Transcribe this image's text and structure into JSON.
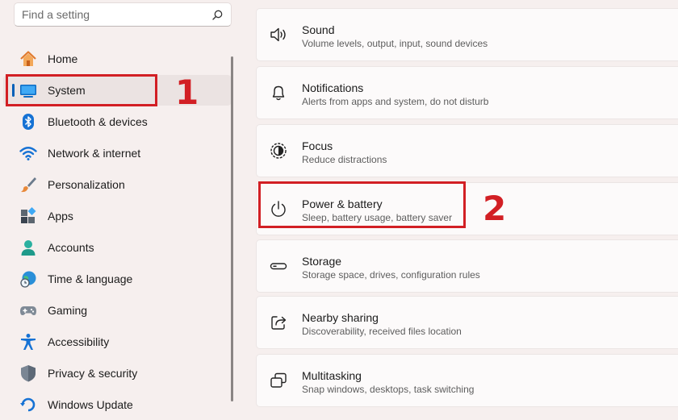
{
  "search": {
    "placeholder": "Find a setting",
    "icon": "search-icon"
  },
  "sidebar": {
    "selected_accent": "#005fb8",
    "items": [
      {
        "label": "Home",
        "icon": "home-icon"
      },
      {
        "label": "System",
        "icon": "system-display-icon",
        "selected": true
      },
      {
        "label": "Bluetooth & devices",
        "icon": "bluetooth-icon"
      },
      {
        "label": "Network & internet",
        "icon": "wifi-icon"
      },
      {
        "label": "Personalization",
        "icon": "paintbrush-icon"
      },
      {
        "label": "Apps",
        "icon": "apps-icon"
      },
      {
        "label": "Accounts",
        "icon": "person-icon"
      },
      {
        "label": "Time & language",
        "icon": "globe-clock-icon"
      },
      {
        "label": "Gaming",
        "icon": "gamepad-icon"
      },
      {
        "label": "Accessibility",
        "icon": "accessibility-icon"
      },
      {
        "label": "Privacy & security",
        "icon": "shield-icon"
      },
      {
        "label": "Windows Update",
        "icon": "update-icon"
      }
    ]
  },
  "main": {
    "cards": [
      {
        "title": "Sound",
        "subtitle": "Volume levels, output, input, sound devices",
        "icon": "speaker-icon"
      },
      {
        "title": "Notifications",
        "subtitle": "Alerts from apps and system, do not disturb",
        "icon": "bell-icon"
      },
      {
        "title": "Focus",
        "subtitle": "Reduce distractions",
        "icon": "focus-icon"
      },
      {
        "title": "Power & battery",
        "subtitle": "Sleep, battery usage, battery saver",
        "icon": "power-icon"
      },
      {
        "title": "Storage",
        "subtitle": "Storage space, drives, configuration rules",
        "icon": "storage-drive-icon"
      },
      {
        "title": "Nearby sharing",
        "subtitle": "Discoverability, received files location",
        "icon": "share-icon"
      },
      {
        "title": "Multitasking",
        "subtitle": "Snap windows, desktops, task switching",
        "icon": "multitasking-icon"
      }
    ]
  },
  "annotations": {
    "step1": "1",
    "step2": "2",
    "highlight_color": "#d21f24"
  }
}
